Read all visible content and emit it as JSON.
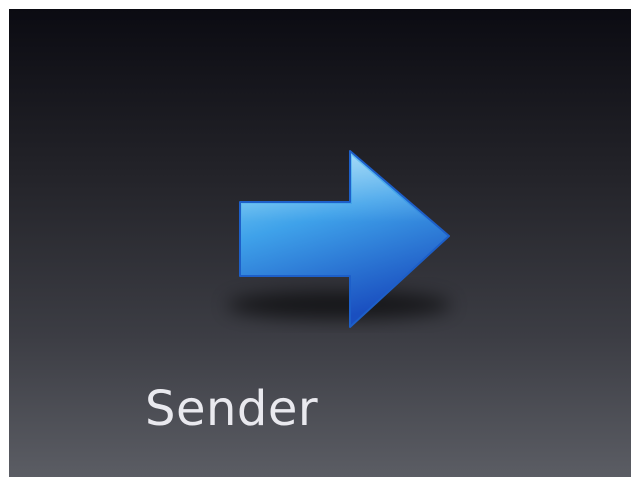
{
  "tile": {
    "label": "Sender",
    "icon": "right-arrow-icon",
    "colors": {
      "background_top": "#0b0b12",
      "background_bottom": "#5b5d64",
      "arrow_light": "#7fd3f5",
      "arrow_dark": "#1a4fc0",
      "label_text": "#e9e9ee"
    }
  }
}
